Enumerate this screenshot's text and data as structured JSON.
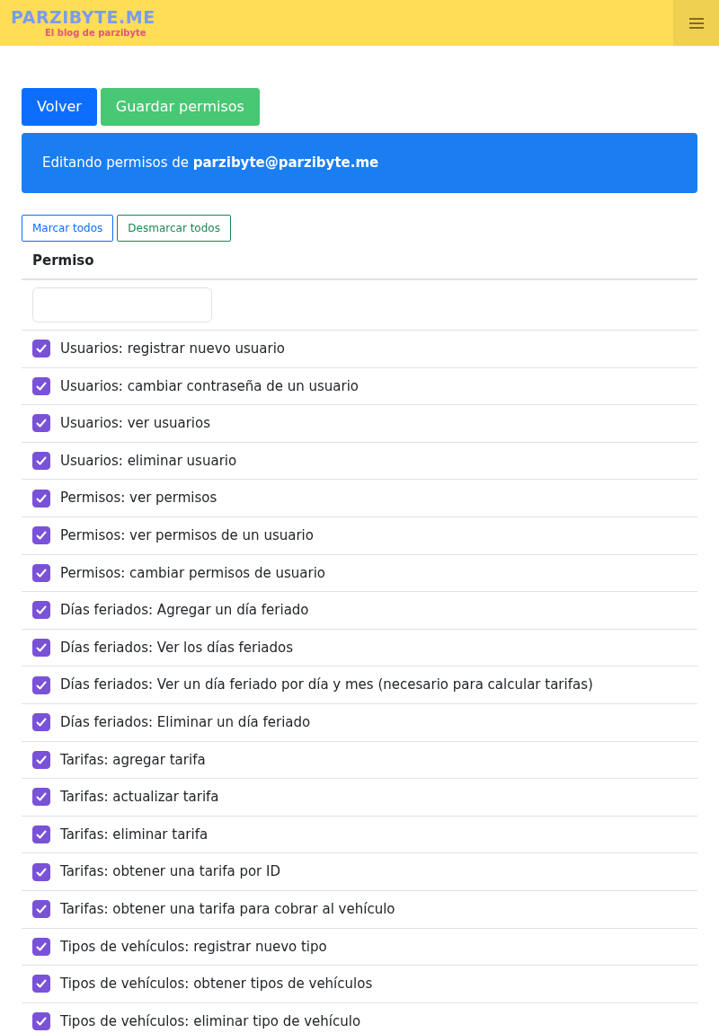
{
  "brand": {
    "title": "PARZIBYTE.ME",
    "subtitle": "El blog de parzibyte"
  },
  "buttons": [
    {
      "label": "Volver",
      "kind": "primary"
    },
    {
      "label": "Guardar permisos",
      "kind": "success"
    }
  ],
  "alert": "Editando permisos de **parzibyte@parzibyte.me**",
  "bulk_buttons": [
    {
      "label": "Marcar todos",
      "kind": "primary"
    },
    {
      "label": "Desmarcar todos",
      "kind": "success"
    }
  ],
  "table": {
    "column": "Permiso",
    "rows": [
      {
        "label": "Usuarios: registrar nuevo usuario",
        "checked": true
      },
      {
        "label": "Usuarios: cambiar contraseña de un usuario",
        "checked": true
      },
      {
        "label": "Usuarios: ver usuarios",
        "checked": true
      },
      {
        "label": "Usuarios: eliminar usuario",
        "checked": true
      },
      {
        "label": "Permisos: ver permisos",
        "checked": true
      },
      {
        "label": "Permisos: ver permisos de un usuario",
        "checked": true
      },
      {
        "label": "Permisos: cambiar permisos de usuario",
        "checked": true
      },
      {
        "label": "Días feriados: Agregar un día feriado",
        "checked": true
      },
      {
        "label": "Días feriados: Ver los días feriados",
        "checked": true
      },
      {
        "label": "Días feriados: Ver un día feriado por día y mes (necesario para calcular tarifas)",
        "checked": true
      },
      {
        "label": "Días feriados: Eliminar un día feriado",
        "checked": true
      },
      {
        "label": "Tarifas: agregar tarifa",
        "checked": true
      },
      {
        "label": "Tarifas: actualizar tarifa",
        "checked": true
      },
      {
        "label": "Tarifas: eliminar tarifa",
        "checked": true
      },
      {
        "label": "Tarifas: obtener una tarifa por ID",
        "checked": true
      },
      {
        "label": "Tarifas: obtener una tarifa para cobrar al vehículo",
        "checked": true
      },
      {
        "label": "Tipos de vehículos: registrar nuevo tipo",
        "checked": true
      },
      {
        "label": "Tipos de vehículos: obtener tipos de vehículos",
        "checked": true
      },
      {
        "label": "Tipos de vehículos: eliminar tipo de vehículo",
        "checked": true
      }
    ]
  }
}
